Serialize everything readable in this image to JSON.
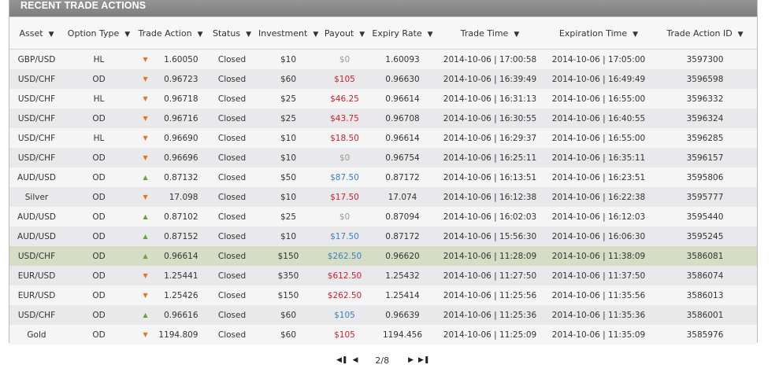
{
  "panel": {
    "title": "RECENT TRADE ACTIONS"
  },
  "columns": [
    {
      "key": "asset",
      "label": "Asset"
    },
    {
      "key": "option_type",
      "label": "Option Type"
    },
    {
      "key": "trade_action",
      "label": "Trade Action"
    },
    {
      "key": "status",
      "label": "Status"
    },
    {
      "key": "investment",
      "label": "Investment"
    },
    {
      "key": "payout",
      "label": "Payout"
    },
    {
      "key": "expiry_rate",
      "label": "Expiry Rate"
    },
    {
      "key": "trade_time",
      "label": "Trade Time"
    },
    {
      "key": "expiration_time",
      "label": "Expiration Time"
    },
    {
      "key": "trade_action_id",
      "label": "Trade Action ID"
    }
  ],
  "colors": {
    "arrow_down": "#e2732a",
    "arrow_up": "#6e9e3d",
    "payout_loss_zero": "#999999",
    "payout_red": "#c8202f",
    "payout_blue": "#3a7fc4",
    "highlight_row": "#d5ddc4"
  },
  "rows": [
    {
      "asset": "GBP/USD",
      "option_type": "HL",
      "direction": "down",
      "trade_action": "1.60050",
      "status": "Closed",
      "investment": "$10",
      "payout": "$0",
      "payout_color": "gray",
      "expiry_rate": "1.60093",
      "trade_time": "2014-10-06 | 17:00:58",
      "expiration_time": "2014-10-06 | 17:05:00",
      "trade_action_id": "3597300"
    },
    {
      "asset": "USD/CHF",
      "option_type": "OD",
      "direction": "down",
      "trade_action": "0.96723",
      "status": "Closed",
      "investment": "$60",
      "payout": "$105",
      "payout_color": "red",
      "expiry_rate": "0.96630",
      "trade_time": "2014-10-06 | 16:39:49",
      "expiration_time": "2014-10-06 | 16:49:49",
      "trade_action_id": "3596598"
    },
    {
      "asset": "USD/CHF",
      "option_type": "HL",
      "direction": "down",
      "trade_action": "0.96718",
      "status": "Closed",
      "investment": "$25",
      "payout": "$46.25",
      "payout_color": "red",
      "expiry_rate": "0.96614",
      "trade_time": "2014-10-06 | 16:31:13",
      "expiration_time": "2014-10-06 | 16:55:00",
      "trade_action_id": "3596332"
    },
    {
      "asset": "USD/CHF",
      "option_type": "OD",
      "direction": "down",
      "trade_action": "0.96716",
      "status": "Closed",
      "investment": "$25",
      "payout": "$43.75",
      "payout_color": "red",
      "expiry_rate": "0.96708",
      "trade_time": "2014-10-06 | 16:30:55",
      "expiration_time": "2014-10-06 | 16:40:55",
      "trade_action_id": "3596324"
    },
    {
      "asset": "USD/CHF",
      "option_type": "HL",
      "direction": "down",
      "trade_action": "0.96690",
      "status": "Closed",
      "investment": "$10",
      "payout": "$18.50",
      "payout_color": "red",
      "expiry_rate": "0.96614",
      "trade_time": "2014-10-06 | 16:29:37",
      "expiration_time": "2014-10-06 | 16:55:00",
      "trade_action_id": "3596285"
    },
    {
      "asset": "USD/CHF",
      "option_type": "OD",
      "direction": "down",
      "trade_action": "0.96696",
      "status": "Closed",
      "investment": "$10",
      "payout": "$0",
      "payout_color": "gray",
      "expiry_rate": "0.96754",
      "trade_time": "2014-10-06 | 16:25:11",
      "expiration_time": "2014-10-06 | 16:35:11",
      "trade_action_id": "3596157"
    },
    {
      "asset": "AUD/USD",
      "option_type": "OD",
      "direction": "up",
      "trade_action": "0.87132",
      "status": "Closed",
      "investment": "$50",
      "payout": "$87.50",
      "payout_color": "blue",
      "expiry_rate": "0.87172",
      "trade_time": "2014-10-06 | 16:13:51",
      "expiration_time": "2014-10-06 | 16:23:51",
      "trade_action_id": "3595806"
    },
    {
      "asset": "Silver",
      "option_type": "OD",
      "direction": "down",
      "trade_action": "17.098",
      "status": "Closed",
      "investment": "$10",
      "payout": "$17.50",
      "payout_color": "red",
      "expiry_rate": "17.074",
      "trade_time": "2014-10-06 | 16:12:38",
      "expiration_time": "2014-10-06 | 16:22:38",
      "trade_action_id": "3595777"
    },
    {
      "asset": "AUD/USD",
      "option_type": "OD",
      "direction": "up",
      "trade_action": "0.87102",
      "status": "Closed",
      "investment": "$25",
      "payout": "$0",
      "payout_color": "gray",
      "expiry_rate": "0.87094",
      "trade_time": "2014-10-06 | 16:02:03",
      "expiration_time": "2014-10-06 | 16:12:03",
      "trade_action_id": "3595440"
    },
    {
      "asset": "AUD/USD",
      "option_type": "OD",
      "direction": "up",
      "trade_action": "0.87152",
      "status": "Closed",
      "investment": "$10",
      "payout": "$17.50",
      "payout_color": "blue",
      "expiry_rate": "0.87172",
      "trade_time": "2014-10-06 | 15:56:30",
      "expiration_time": "2014-10-06 | 16:06:30",
      "trade_action_id": "3595245"
    },
    {
      "asset": "USD/CHF",
      "option_type": "OD",
      "direction": "up",
      "trade_action": "0.96614",
      "status": "Closed",
      "investment": "$150",
      "payout": "$262.50",
      "payout_color": "blue",
      "expiry_rate": "0.96620",
      "trade_time": "2014-10-06 | 11:28:09",
      "expiration_time": "2014-10-06 | 11:38:09",
      "trade_action_id": "3586081",
      "highlighted": true
    },
    {
      "asset": "EUR/USD",
      "option_type": "OD",
      "direction": "down",
      "trade_action": "1.25441",
      "status": "Closed",
      "investment": "$350",
      "payout": "$612.50",
      "payout_color": "red",
      "expiry_rate": "1.25432",
      "trade_time": "2014-10-06 | 11:27:50",
      "expiration_time": "2014-10-06 | 11:37:50",
      "trade_action_id": "3586074"
    },
    {
      "asset": "EUR/USD",
      "option_type": "OD",
      "direction": "down",
      "trade_action": "1.25426",
      "status": "Closed",
      "investment": "$150",
      "payout": "$262.50",
      "payout_color": "red",
      "expiry_rate": "1.25414",
      "trade_time": "2014-10-06 | 11:25:56",
      "expiration_time": "2014-10-06 | 11:35:56",
      "trade_action_id": "3586013"
    },
    {
      "asset": "USD/CHF",
      "option_type": "OD",
      "direction": "up",
      "trade_action": "0.96616",
      "status": "Closed",
      "investment": "$60",
      "payout": "$105",
      "payout_color": "blue",
      "expiry_rate": "0.96639",
      "trade_time": "2014-10-06 | 11:25:36",
      "expiration_time": "2014-10-06 | 11:35:36",
      "trade_action_id": "3586001"
    },
    {
      "asset": "Gold",
      "option_type": "OD",
      "direction": "down",
      "trade_action": "1194.809",
      "status": "Closed",
      "investment": "$60",
      "payout": "$105",
      "payout_color": "red",
      "expiry_rate": "1194.456",
      "trade_time": "2014-10-06 | 11:25:09",
      "expiration_time": "2014-10-06 | 11:35:09",
      "trade_action_id": "3585976"
    }
  ],
  "pagination": {
    "current_page": 2,
    "total_pages": 8,
    "label": "2/8"
  }
}
